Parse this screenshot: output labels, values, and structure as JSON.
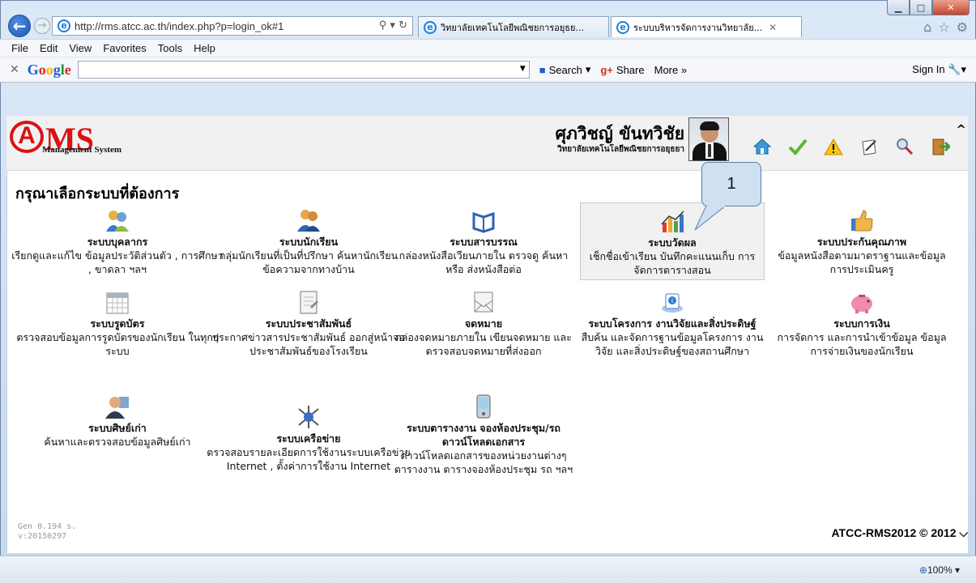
{
  "browser": {
    "address": "http://rms.atcc.ac.th/index.php?p=login_ok#1",
    "tabs": [
      {
        "label": "วิทยาลัยเทคโนโลยีพณิชยการอยุธย..."
      },
      {
        "label": "ระบบบริหารจัดการงานวิทยาลัย..."
      }
    ],
    "menu": [
      "File",
      "Edit",
      "View",
      "Favorites",
      "Tools",
      "Help"
    ],
    "google": {
      "logo": "Google",
      "search": "Search",
      "share": "Share",
      "more": "More »",
      "signin": "Sign In"
    },
    "zoom": "100%"
  },
  "header": {
    "logo_main": "MS",
    "logo_sub": "Management System",
    "user_name": "ศุภวิชญ์ ขันทวิชัย",
    "user_org": "วิทยาลัยเทคโนโลยีพณิชยการอยุธยา"
  },
  "page_title": "กรุณาเลือกระบบที่ต้องการ",
  "callout": "1",
  "modules": [
    {
      "title": "ระบบบุคลากร",
      "desc": "เรียกดูและแก้ไข ข้อมูลประวัติส่วนตัว , การศึกษา , ขาดลา ฯลฯ",
      "icon": "people-icon"
    },
    {
      "title": "ระบบนักเรียน",
      "desc": "กลุ่มนักเรียนที่เป็นที่ปรึกษา ค้นหานักเรียน ข้อความจากทางบ้าน",
      "icon": "students-icon"
    },
    {
      "title": "ระบบสารบรรณ",
      "desc": "กล่องหนังสือเวียนภายใน ตรวจดู ค้นหา หรือ ส่งหนังสือต่อ",
      "icon": "book-icon"
    },
    {
      "title": "ระบบวัดผล",
      "desc": "เช็กชื่อเข้าเรียน บันทึกคะแนนเก็บ การจัดการตารางสอน",
      "icon": "chart-icon"
    },
    {
      "title": "ระบบประกันคุณภาพ",
      "desc": "ข้อมูลหนังสือตามมาตราฐานและข้อมูลการประเมินครู",
      "icon": "thumbs-up-icon"
    },
    {
      "title": "ระบบรูดบัตร",
      "desc": "ตรวจสอบข้อมูลการรูดบัตรของนักเรียน ในทุกๆ ระบบ",
      "icon": "calendar-icon"
    },
    {
      "title": "ระบบประชาสัมพันธ์",
      "desc": "ประกาศข่าวสารประชาสัมพันธ์ ออกสู่หน้าจอประชาสัมพันธ์ของโรงเรียน",
      "icon": "notepad-icon"
    },
    {
      "title": "จดหมาย",
      "desc": "กล่องจดหมายภายใน เขียนจดหมาย และตรวจสอบจดหมายที่ส่งออก",
      "icon": "mail-icon"
    },
    {
      "title": "ระบบโครงการ งานวิจัยและสิ่งประดิษฐ์",
      "desc": "สืบค้น และจัดการฐานข้อมูลโครงการ งานวิจัย และสิ่งประดิษฐ์ของสถานศึกษา",
      "icon": "research-icon"
    },
    {
      "title": "ระบบการเงิน",
      "desc": "การจัดการ และการนำเข้าข้อมูล ข้อมูลการจ่ายเงินของนักเรียน",
      "icon": "piggy-bank-icon"
    },
    {
      "title": "ระบบศิษย์เก่า",
      "desc": "ค้นหาและตรวจสอบข้อมูลศิษย์เก่า",
      "icon": "alumni-icon"
    },
    {
      "title": "ระบบเครือข่าย",
      "desc": "ตรวจสอบรายละเอียดการใช้งานระบบเครือข่าย Internet , ตั้งค่าการใช้งาน Internet",
      "icon": "network-icon"
    },
    {
      "title": "ระบบตารางงาน จองห้องประชุม/รถ ดาวน์โหลดเอกสาร",
      "desc": "ดาวน์โหลดเอกสารของหน่วยงานต่างๆ ตารางงาน ตารางจองห้องประชุม รถ ฯลฯ",
      "icon": "pda-icon"
    }
  ],
  "footer": {
    "gen": "Gen 0.194 s.",
    "version": "v:20150297",
    "copyright": "ATCC-RMS2012 © 2012"
  }
}
